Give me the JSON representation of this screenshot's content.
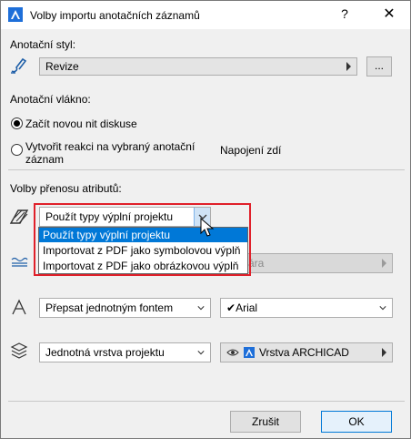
{
  "window": {
    "title": "Volby importu anotačních záznamů",
    "help_glyph": "?",
    "close_glyph": "✕"
  },
  "annotation_style": {
    "heading": "Anotační styl:",
    "value": "Revize",
    "browse_label": "..."
  },
  "annotation_thread": {
    "heading": "Anotační vlákno:",
    "options": [
      {
        "label": "Začít novou nit diskuse",
        "checked": true
      },
      {
        "label_line1": "Vytvořit reakci na vybraný anotační",
        "label_line2": "záznam",
        "checked": false
      }
    ],
    "selected_thread_label": "Napojení zdí"
  },
  "attribute_transfer": {
    "heading": "Volby přenosu atributů:",
    "fill_select": {
      "value": "Použít typy výplní projektu",
      "options": [
        "Použít typy výplní projektu",
        "Importovat z PDF jako symbolovou výplň",
        "Importovat z PDF jako obrázkovou výplň"
      ],
      "highlighted_index": 0
    },
    "line_type_hidden_value_fragment": "ára",
    "font_select": {
      "value": "Přepsat jednotným fontem"
    },
    "font_name": {
      "check": "✔",
      "value": "Arial"
    },
    "layer_select": {
      "value": "Jednotná vrstva projektu"
    },
    "layer_name": {
      "value": "Vrstva ARCHICAD"
    }
  },
  "footer": {
    "cancel_label": "Zrušit",
    "ok_label": "OK"
  },
  "colors": {
    "highlight": "#0078d7",
    "focus_outline": "#e0202a",
    "title_icon": "#1e6fd9"
  }
}
